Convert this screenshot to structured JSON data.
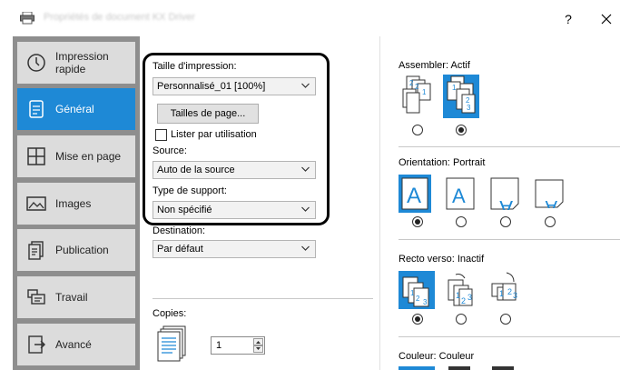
{
  "window": {
    "title": "Propriétés de document KX Driver",
    "help_symbol": "?",
    "close_symbol": "✕"
  },
  "sidebar": {
    "items": [
      {
        "label": "Impression rapide",
        "icon": "clock-icon",
        "active": false
      },
      {
        "label": "Général",
        "icon": "document-icon",
        "active": true
      },
      {
        "label": "Mise en page",
        "icon": "layout-grid-icon",
        "active": false
      },
      {
        "label": "Images",
        "icon": "image-icon",
        "active": false
      },
      {
        "label": "Publication",
        "icon": "publication-icon",
        "active": false
      },
      {
        "label": "Travail",
        "icon": "job-icon",
        "active": false
      },
      {
        "label": "Avancé",
        "icon": "advanced-icon",
        "active": false
      }
    ]
  },
  "general": {
    "print_size_label": "Taille d'impression:",
    "print_size_value": "Personnalisé_01 [100%]",
    "page_sizes_button": "Tailles de page...",
    "list_by_usage_label": "Lister par utilisation",
    "list_by_usage_checked": false,
    "source_label": "Source:",
    "source_value": "Auto de la source",
    "media_type_label": "Type de support:",
    "media_type_value": "Non spécifié",
    "destination_label": "Destination:",
    "destination_value": "Par défaut",
    "copies_label": "Copies:",
    "copies_value": "1"
  },
  "options": {
    "collate_label": "Assembler:",
    "collate_value": "Actif",
    "orientation_label": "Orientation:",
    "orientation_value": "Portrait",
    "duplex_label": "Recto verso:",
    "duplex_value": "Inactif",
    "color_label": "Couleur:",
    "color_value": "Couleur"
  },
  "colors": {
    "accent": "#1e89d6",
    "sidebar_bg": "#8e8e8e",
    "nav_item_bg": "#dcdcdc"
  }
}
